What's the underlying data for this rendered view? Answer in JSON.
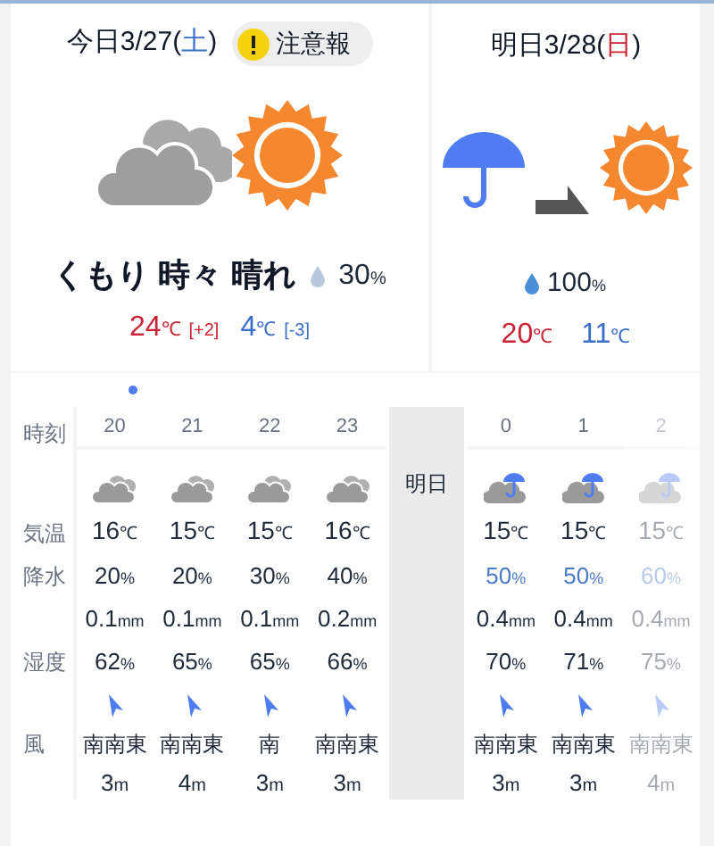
{
  "today": {
    "label": "今日",
    "date": "3/27",
    "open": "(",
    "weekday": "土",
    "close": ")",
    "warning": "注意報",
    "kind": "cloud-sun",
    "condition": "くもり 時々 晴れ",
    "precip": "30",
    "precip_unit": "%",
    "high": "24",
    "high_unit": "℃",
    "high_diff": "[+2]",
    "low": "4",
    "low_unit": "℃",
    "low_diff": "[-3]"
  },
  "tomorrow": {
    "label": "明日",
    "date": "3/28",
    "open": "(",
    "weekday": "日",
    "close": ")",
    "kind": "rain-to-sun",
    "precip": "100",
    "precip_unit": "%",
    "high": "20",
    "high_unit": "℃",
    "low": "11",
    "low_unit": "℃"
  },
  "row_labels": {
    "time": "時刻",
    "temp": "気温",
    "precip": "降水",
    "humidity": "湿度",
    "wind": "風"
  },
  "divider_label": "明日",
  "today_hours": [
    {
      "hour": "20",
      "kind": "cloud",
      "temp": "16",
      "temp_unit": "℃",
      "precip": "20",
      "precip_unit": "%",
      "rainy": false,
      "amount": "0.1",
      "amount_unit": "mm",
      "humidity": "62",
      "humidity_unit": "%",
      "dir": "南南東",
      "speed": "3",
      "speed_unit": "m",
      "faded": false
    },
    {
      "hour": "21",
      "kind": "cloud",
      "temp": "15",
      "temp_unit": "℃",
      "precip": "20",
      "precip_unit": "%",
      "rainy": false,
      "amount": "0.1",
      "amount_unit": "mm",
      "humidity": "65",
      "humidity_unit": "%",
      "dir": "南南東",
      "speed": "4",
      "speed_unit": "m",
      "faded": false
    },
    {
      "hour": "22",
      "kind": "cloud",
      "temp": "15",
      "temp_unit": "℃",
      "precip": "30",
      "precip_unit": "%",
      "rainy": false,
      "amount": "0.1",
      "amount_unit": "mm",
      "humidity": "65",
      "humidity_unit": "%",
      "dir": "南",
      "speed": "3",
      "speed_unit": "m",
      "faded": false
    },
    {
      "hour": "23",
      "kind": "cloud",
      "temp": "16",
      "temp_unit": "℃",
      "precip": "40",
      "precip_unit": "%",
      "rainy": false,
      "amount": "0.2",
      "amount_unit": "mm",
      "humidity": "66",
      "humidity_unit": "%",
      "dir": "南南東",
      "speed": "3",
      "speed_unit": "m",
      "faded": false
    }
  ],
  "tomorrow_hours": [
    {
      "hour": "0",
      "kind": "cloud-rain",
      "temp": "15",
      "temp_unit": "℃",
      "precip": "50",
      "precip_unit": "%",
      "rainy": true,
      "amount": "0.4",
      "amount_unit": "mm",
      "humidity": "70",
      "humidity_unit": "%",
      "dir": "南南東",
      "speed": "3",
      "speed_unit": "m",
      "faded": false
    },
    {
      "hour": "1",
      "kind": "cloud-rain",
      "temp": "15",
      "temp_unit": "℃",
      "precip": "50",
      "precip_unit": "%",
      "rainy": true,
      "amount": "0.4",
      "amount_unit": "mm",
      "humidity": "71",
      "humidity_unit": "%",
      "dir": "南南東",
      "speed": "3",
      "speed_unit": "m",
      "faded": false
    },
    {
      "hour": "2",
      "kind": "cloud-rain",
      "temp": "15",
      "temp_unit": "℃",
      "precip": "60",
      "precip_unit": "%",
      "rainy": true,
      "amount": "0.4",
      "amount_unit": "mm",
      "humidity": "75",
      "humidity_unit": "%",
      "dir": "南南東",
      "speed": "4",
      "speed_unit": "m",
      "faded": true
    }
  ]
}
